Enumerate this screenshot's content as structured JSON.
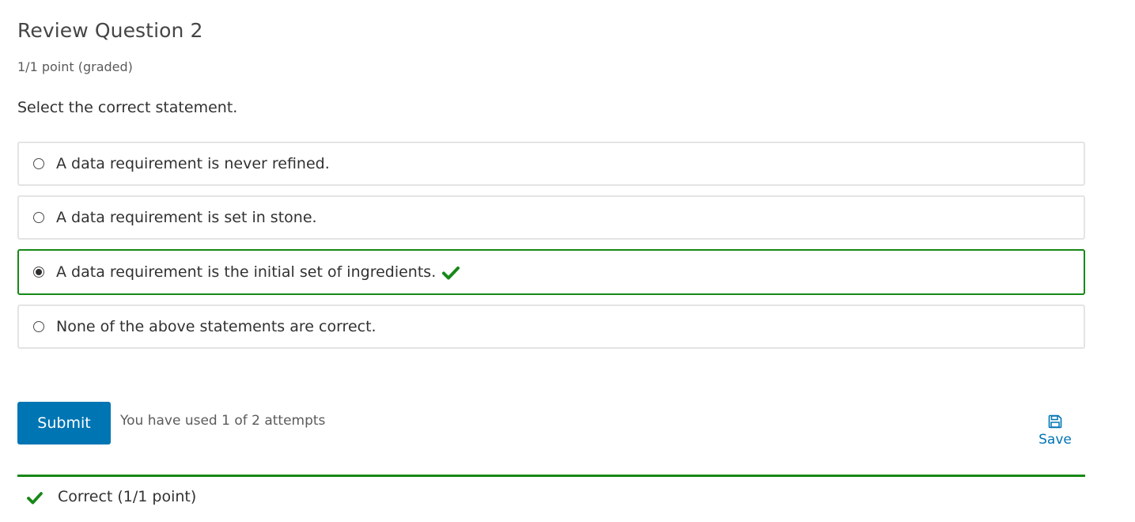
{
  "question": {
    "title": "Review Question 2",
    "points": "1/1 point (graded)",
    "prompt": "Select the correct statement."
  },
  "choices": [
    {
      "label": "A data requirement is never refined.",
      "selected": false,
      "correct": false
    },
    {
      "label": "A data requirement is set in stone.",
      "selected": false,
      "correct": false
    },
    {
      "label": "A data requirement is the initial set of ingredients.",
      "selected": true,
      "correct": true
    },
    {
      "label": "None of the above statements are correct.",
      "selected": false,
      "correct": false
    }
  ],
  "actions": {
    "submit_label": "Submit",
    "attempts_text": "You have used 1 of 2 attempts",
    "save_label": "Save",
    "save_icon": "floppy-disk-icon"
  },
  "feedback": {
    "text": "Correct (1/1 point)",
    "icon": "checkmark-icon"
  },
  "colors": {
    "accent": "#0075b4",
    "correct": "#178817",
    "border": "#e4e4e4"
  }
}
